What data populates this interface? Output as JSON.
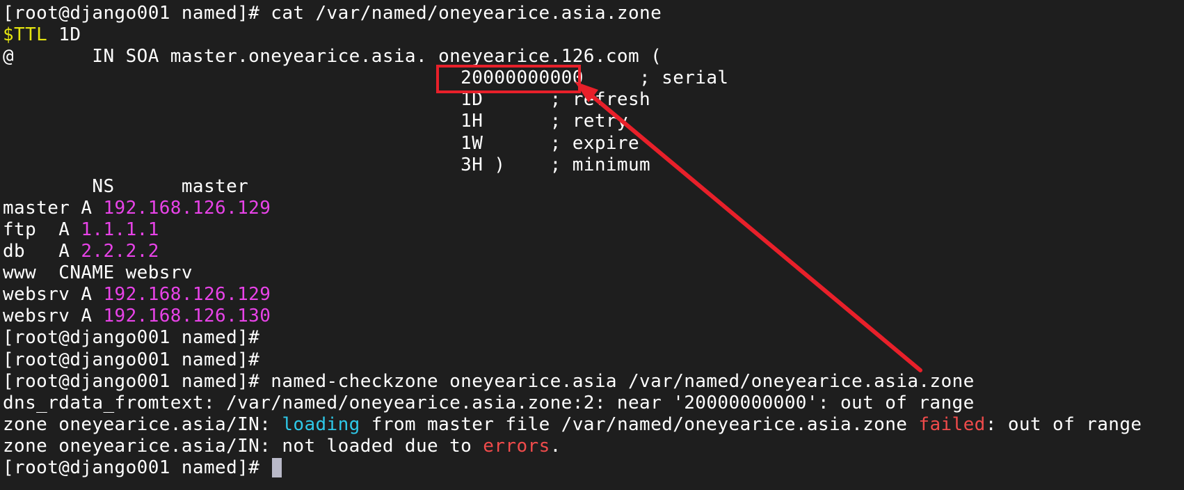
{
  "terminal": {
    "lines": [
      {
        "parts": [
          {
            "text": "[root@django001 named]# cat /var/named/oneyearice.asia.zone",
            "color": "white"
          }
        ]
      },
      {
        "parts": [
          {
            "text": "$TTL",
            "color": "yellow"
          },
          {
            "text": " 1D",
            "color": "white"
          }
        ]
      },
      {
        "parts": [
          {
            "text": "@       IN SOA master.oneyearice.asia. oneyearice.126.com (",
            "color": "white"
          }
        ]
      },
      {
        "parts": [
          {
            "text": "                                         20000000000     ; serial",
            "color": "white"
          }
        ]
      },
      {
        "parts": [
          {
            "text": "                                         1D      ; refresh",
            "color": "white"
          }
        ]
      },
      {
        "parts": [
          {
            "text": "                                         1H      ; retry",
            "color": "white"
          }
        ]
      },
      {
        "parts": [
          {
            "text": "                                         1W      ; expire",
            "color": "white"
          }
        ]
      },
      {
        "parts": [
          {
            "text": "                                         3H )    ; minimum",
            "color": "white"
          }
        ]
      },
      {
        "parts": [
          {
            "text": "        NS      master",
            "color": "white"
          }
        ]
      },
      {
        "parts": [
          {
            "text": "master A ",
            "color": "white"
          },
          {
            "text": "192.168.126.129",
            "color": "magenta"
          }
        ]
      },
      {
        "parts": [
          {
            "text": "ftp  A ",
            "color": "white"
          },
          {
            "text": "1.1.1.1",
            "color": "magenta"
          }
        ]
      },
      {
        "parts": [
          {
            "text": "db   A ",
            "color": "white"
          },
          {
            "text": "2.2.2.2",
            "color": "magenta"
          }
        ]
      },
      {
        "parts": [
          {
            "text": "www  CNAME websrv",
            "color": "white"
          }
        ]
      },
      {
        "parts": [
          {
            "text": "websrv A ",
            "color": "white"
          },
          {
            "text": "192.168.126.129",
            "color": "magenta"
          }
        ]
      },
      {
        "parts": [
          {
            "text": "websrv A ",
            "color": "white"
          },
          {
            "text": "192.168.126.130",
            "color": "magenta"
          }
        ]
      },
      {
        "parts": [
          {
            "text": "[root@django001 named]#",
            "color": "white"
          }
        ]
      },
      {
        "parts": [
          {
            "text": "[root@django001 named]#",
            "color": "white"
          }
        ]
      },
      {
        "parts": [
          {
            "text": "[root@django001 named]# named-checkzone oneyearice.asia /var/named/oneyearice.asia.zone",
            "color": "white"
          }
        ]
      },
      {
        "parts": [
          {
            "text": "dns_rdata_fromtext: /var/named/oneyearice.asia.zone:2: near '20000000000': out of range",
            "color": "white"
          }
        ]
      },
      {
        "parts": [
          {
            "text": "zone oneyearice.asia/IN: ",
            "color": "white"
          },
          {
            "text": "loading",
            "color": "cyan"
          },
          {
            "text": " from master file /var/named/oneyearice.asia.zone ",
            "color": "white"
          },
          {
            "text": "failed",
            "color": "red"
          },
          {
            "text": ": out of range",
            "color": "white"
          }
        ]
      },
      {
        "parts": [
          {
            "text": "zone oneyearice.asia/IN: not loaded due to ",
            "color": "white"
          },
          {
            "text": "errors",
            "color": "red"
          },
          {
            "text": ".",
            "color": "white"
          }
        ]
      },
      {
        "parts": [
          {
            "text": "[root@django001 named]# ",
            "color": "white"
          }
        ],
        "cursor": true
      }
    ]
  },
  "annotation": {
    "color": "#e8202a",
    "shapes": [
      "highlight-box",
      "arrow"
    ]
  }
}
